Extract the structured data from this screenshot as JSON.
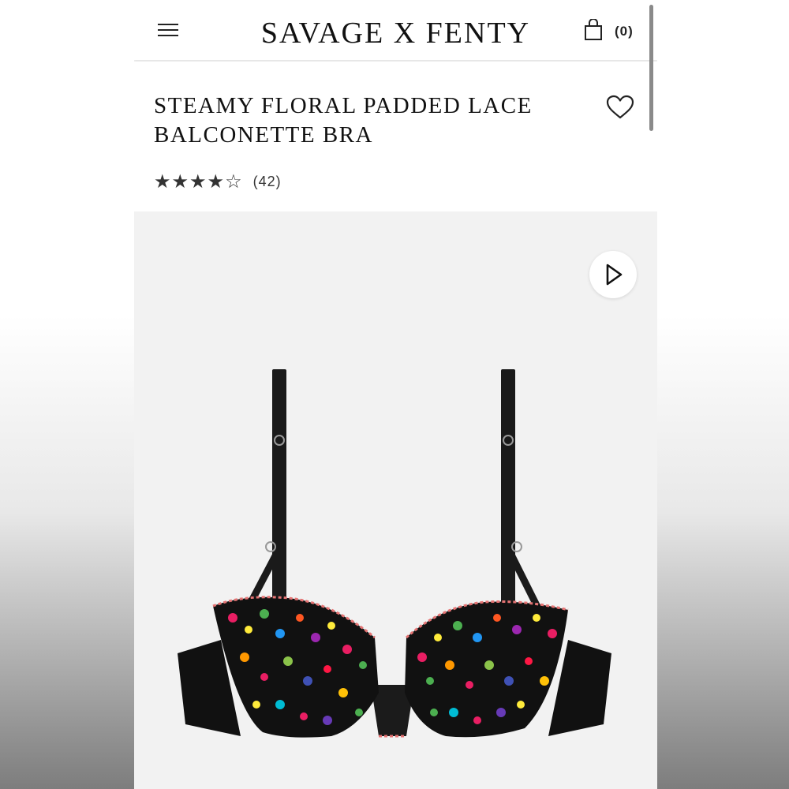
{
  "header": {
    "brand": "SAVAGE X FENTY",
    "bag_count": "(0)",
    "icons": [
      "hamburger-menu-icon",
      "shopping-bag-icon"
    ]
  },
  "product": {
    "title": "STEAMY FLORAL PADDED LACE BALCONETTE BRA",
    "rating_stars": "★★★★☆",
    "rating_value": 4,
    "rating_max": 5,
    "review_count": "(42)"
  },
  "gallery": {
    "icons": [
      "play-video-icon",
      "wishlist-heart-icon"
    ]
  },
  "colors": {
    "background": "#f2f2f2",
    "text": "#111111",
    "header_bg": "#ffffff"
  }
}
